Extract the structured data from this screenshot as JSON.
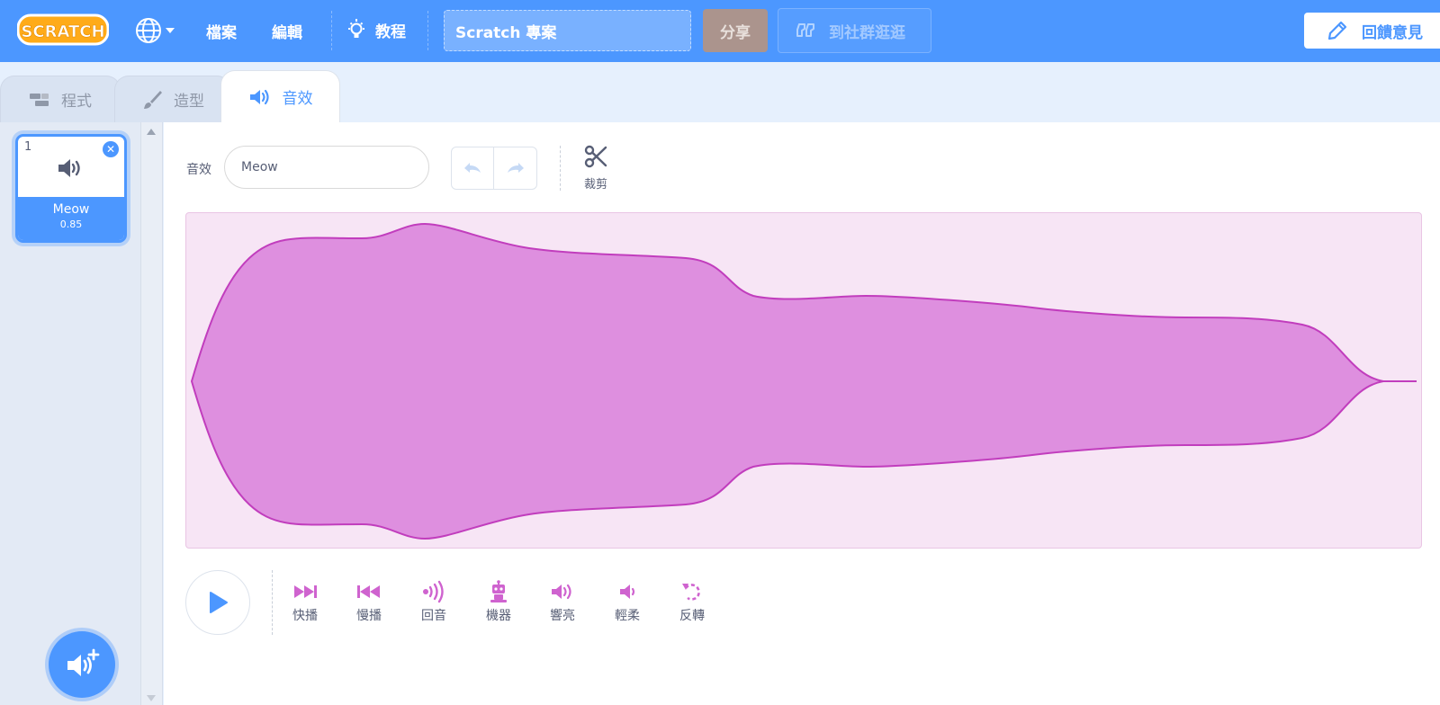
{
  "menubar": {
    "logo_text": "SCRATCH",
    "language_icon": "globe-icon",
    "file_label": "檔案",
    "edit_label": "編輯",
    "tutorials_label": "教程",
    "project_title": "Scratch 專案",
    "share_label": "分享",
    "community_label": "到社群逛逛",
    "feedback_label": "回饋意見"
  },
  "tabs": [
    {
      "label": "程式",
      "icon": "code-icon",
      "active": false
    },
    {
      "label": "造型",
      "icon": "brush-icon",
      "active": false
    },
    {
      "label": "音效",
      "icon": "speaker-icon",
      "active": true
    }
  ],
  "sound_list": {
    "items": [
      {
        "number": "1",
        "name": "Meow",
        "duration": "0.85",
        "selected": true
      }
    ]
  },
  "editor": {
    "sound_label": "音效",
    "sound_name": "Meow",
    "trim_label": "裁剪",
    "effects": [
      {
        "label": "快播",
        "icon": "faster-icon"
      },
      {
        "label": "慢播",
        "icon": "slower-icon"
      },
      {
        "label": "回音",
        "icon": "echo-icon"
      },
      {
        "label": "機器",
        "icon": "robot-icon"
      },
      {
        "label": "響亮",
        "icon": "louder-icon"
      },
      {
        "label": "輕柔",
        "icon": "softer-icon"
      },
      {
        "label": "反轉",
        "icon": "reverse-icon"
      }
    ]
  },
  "colors": {
    "menu_blue": "#4c97ff",
    "wave_fill": "#de8fdf",
    "wave_stroke": "#c13dbd",
    "wave_bg": "#f7e5f5",
    "effect_magenta": "#cf63cf"
  }
}
